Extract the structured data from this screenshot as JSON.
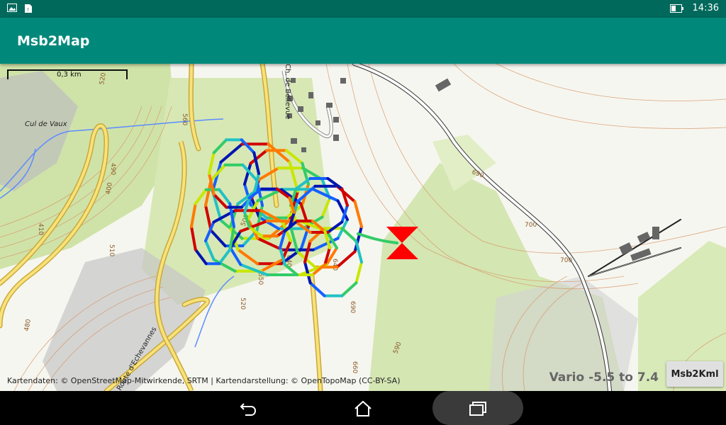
{
  "status": {
    "time": "14:36"
  },
  "app": {
    "title": "Msb2Map"
  },
  "map": {
    "scale_label": "0,3 km",
    "place_labels": [
      "Cul de Vaux",
      "Ch. de Bellevue",
      "Route d'Echevannes"
    ],
    "contour_labels": [
      "520",
      "560",
      "510",
      "490",
      "410",
      "500",
      "690",
      "640",
      "690",
      "700",
      "700",
      "660",
      "590",
      "550",
      "520",
      "640",
      "480",
      "400"
    ],
    "attribution": "Kartendaten: © OpenStreetMap-Mitwirkende, SRTM | Kartendarstellung: © OpenTopoMap (CC-BY-SA)",
    "vario_label": "Vario -5.5 to 7.4",
    "button_label": "Msb2Kml",
    "track_colors": [
      "#d00000",
      "#ff7a00",
      "#c8e600",
      "#33cc66",
      "#22c1c3",
      "#1560ff",
      "#0015b0"
    ]
  }
}
